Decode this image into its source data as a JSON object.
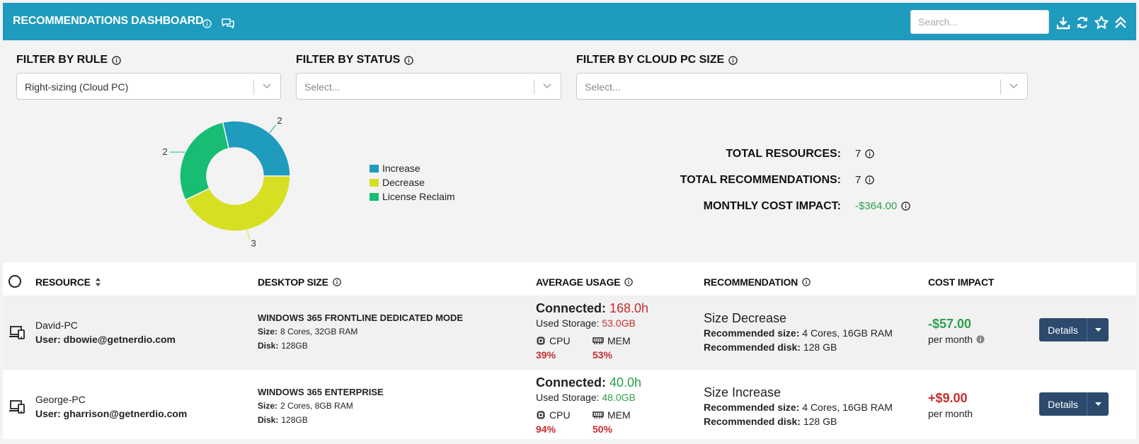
{
  "header": {
    "title": "RECOMMENDATIONS DASHBOARD",
    "search_placeholder": "Search..."
  },
  "filters": [
    {
      "label": "FILTER BY RULE",
      "value": "Right-sizing (Cloud PC)",
      "placeholder": ""
    },
    {
      "label": "FILTER BY STATUS",
      "value": "",
      "placeholder": "Select..."
    },
    {
      "label": "FILTER BY CLOUD PC SIZE",
      "value": "",
      "placeholder": "Select..."
    }
  ],
  "chart_data": {
    "type": "pie",
    "donut": true,
    "categories": [
      "Increase",
      "Decrease",
      "License Reclaim"
    ],
    "values": [
      2,
      3,
      2
    ],
    "colors": [
      "#1e9bbd",
      "#d7df23",
      "#16bd73"
    ],
    "legend_position": "right"
  },
  "stats": {
    "total_resources_label": "TOTAL RESOURCES:",
    "total_resources": "7",
    "total_recommendations_label": "TOTAL RECOMMENDATIONS:",
    "total_recommendations": "7",
    "monthly_cost_label": "MONTHLY COST IMPACT:",
    "monthly_cost": "-$364.00"
  },
  "table": {
    "headers": {
      "resource": "RESOURCE",
      "desktop_size": "DESKTOP SIZE",
      "average_usage": "AVERAGE USAGE",
      "recommendation": "RECOMMENDATION",
      "cost_impact": "COST IMPACT"
    },
    "rows": [
      {
        "name": "David-PC",
        "user": "User: dbowie@getnerdio.com",
        "desktop": "WINDOWS 365 FRONTLINE DEDICATED MODE",
        "size_label": "Size:",
        "size": "8 Cores, 32GB RAM",
        "disk_label": "Disk:",
        "disk": "128GB",
        "connected_label": "Connected:",
        "connected": "168.0h",
        "storage_label": "Used Storage:",
        "storage": "53.0GB",
        "cpu_label": "CPU",
        "cpu": "39%",
        "mem_label": "MEM",
        "mem": "53%",
        "rec_title": "Size Decrease",
        "rec_size_label": "Recommended size:",
        "rec_size": "4 Cores, 16GB RAM",
        "rec_disk_label": "Recommended disk:",
        "rec_disk": "128 GB",
        "cost": "-$57.00",
        "per": "per month",
        "details": "Details"
      },
      {
        "name": "George-PC",
        "user": "User: gharrison@getnerdio.com",
        "desktop": "WINDOWS 365 ENTERPRISE",
        "size_label": "Size:",
        "size": "2 Cores, 8GB RAM",
        "disk_label": "Disk:",
        "disk": "128GB",
        "connected_label": "Connected:",
        "connected": "40.0h",
        "storage_label": "Used Storage:",
        "storage": "48.0GB",
        "cpu_label": "CPU",
        "cpu": "94%",
        "mem_label": "MEM",
        "mem": "50%",
        "rec_title": "Size Increase",
        "rec_size_label": "Recommended size:",
        "rec_size": "4 Cores, 16GB RAM",
        "rec_disk_label": "Recommended disk:",
        "rec_disk": "128 GB",
        "cost": "+$9.00",
        "per": "per month",
        "details": "Details"
      }
    ]
  }
}
